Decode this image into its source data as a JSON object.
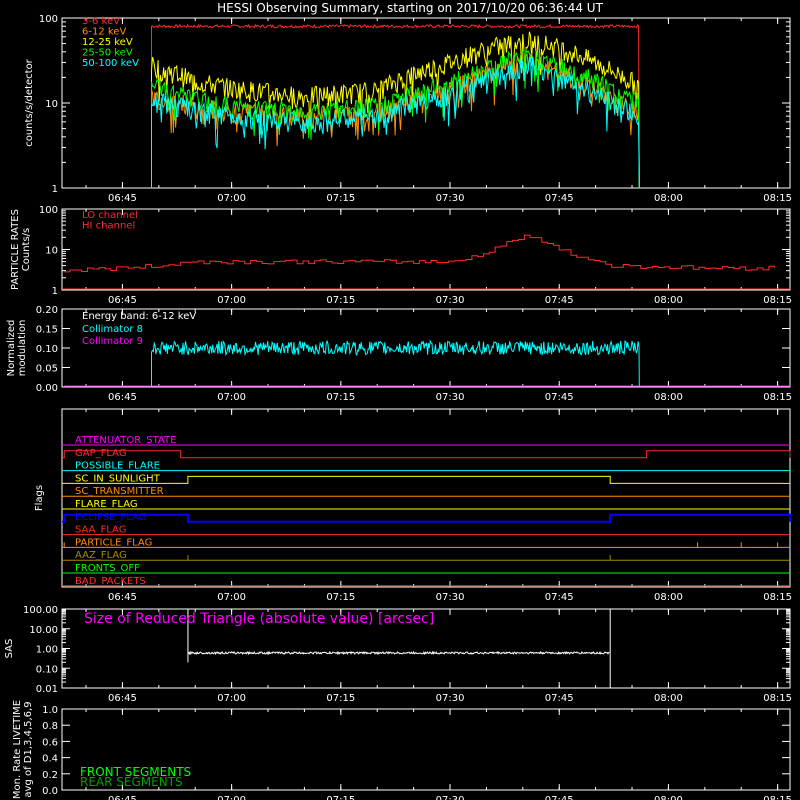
{
  "title": "HESSI Observing Summary, starting on 2017/10/20 06:36:44 UT",
  "colors": {
    "axis": "#ffffff",
    "red": "#ff2a2a",
    "orange": "#ff8c00",
    "yellow": "#ffff00",
    "green": "#00ff00",
    "cyan": "#00ffff",
    "magenta": "#ff00ff",
    "blue": "#0000ff",
    "olive": "#a09000",
    "dkgreen": "#00a000",
    "white": "#ffffff"
  },
  "time_axis": {
    "start_min": 396.7,
    "end_min": 496.7,
    "ticks": [
      {
        "min": 405,
        "label": "06:45"
      },
      {
        "min": 420,
        "label": "07:00"
      },
      {
        "min": 435,
        "label": "07:15"
      },
      {
        "min": 450,
        "label": "07:30"
      },
      {
        "min": 465,
        "label": "07:45"
      },
      {
        "min": 480,
        "label": "08:00"
      },
      {
        "min": 495,
        "label": "08:15"
      }
    ]
  },
  "chart_data": [
    {
      "id": "counts",
      "type": "line",
      "ylabel": "counts/s/detector",
      "yscale": "log",
      "ylim": [
        1,
        100
      ],
      "yticks": [
        {
          "v": 1,
          "label": "1"
        },
        {
          "v": 10,
          "label": "10"
        },
        {
          "v": 100,
          "label": "100"
        }
      ],
      "legend_placement": "top-left",
      "x": [
        "06:49",
        "06:55",
        "07:00",
        "07:10",
        "07:20",
        "07:30",
        "07:37",
        "07:41",
        "07:45",
        "07:50",
        "07:53",
        "07:56"
      ],
      "series": [
        {
          "name": "3-6 keV",
          "color": "red",
          "values": [
            80,
            80,
            80,
            80,
            80,
            80,
            80,
            80,
            80,
            80,
            80,
            80
          ]
        },
        {
          "name": "6-12 keV",
          "color": "orange",
          "values": [
            12,
            9,
            8,
            7,
            8,
            14,
            25,
            30,
            22,
            15,
            10,
            8
          ]
        },
        {
          "name": "12-25 keV",
          "color": "yellow",
          "values": [
            28,
            18,
            15,
            12,
            14,
            30,
            48,
            55,
            45,
            30,
            22,
            16
          ]
        },
        {
          "name": "25-50 keV",
          "color": "green",
          "values": [
            16,
            11,
            9,
            8,
            9,
            17,
            30,
            36,
            27,
            18,
            13,
            10
          ]
        },
        {
          "name": "50-100 keV",
          "color": "cyan",
          "values": [
            11,
            8,
            7,
            6,
            7,
            13,
            22,
            28,
            20,
            13,
            9,
            7
          ]
        }
      ]
    },
    {
      "id": "particle",
      "type": "line",
      "ylabel": "PARTICLE RATES\nCounts/s",
      "yscale": "log",
      "ylim": [
        1,
        100
      ],
      "yticks": [
        {
          "v": 1,
          "label": "1"
        },
        {
          "v": 10,
          "label": "10"
        },
        {
          "v": 100,
          "label": "100"
        }
      ],
      "legend_placement": "top-left",
      "x": [
        "06:37",
        "06:45",
        "06:50",
        "06:55",
        "07:10",
        "07:30",
        "07:35",
        "07:38",
        "07:40",
        "07:43",
        "07:47",
        "07:52",
        "08:05",
        "08:15"
      ],
      "series": [
        {
          "name": "LO channel",
          "color": "red",
          "values": []
        },
        {
          "name": "HI channel",
          "color": "red",
          "values": [
            3,
            3.5,
            4,
            5,
            5,
            5,
            8,
            15,
            22,
            15,
            7,
            4,
            3.5,
            3.5
          ]
        }
      ]
    },
    {
      "id": "modulation",
      "type": "line",
      "ylabel": "Normalized\nmodulation",
      "ylim": [
        0,
        0.2
      ],
      "yticks": [
        {
          "v": 0,
          "label": "0.00"
        },
        {
          "v": 0.05,
          "label": "0.05"
        },
        {
          "v": 0.1,
          "label": "0.10"
        },
        {
          "v": 0.15,
          "label": "0.15"
        },
        {
          "v": 0.2,
          "label": "0.20"
        }
      ],
      "legend_placement": "top-left",
      "annotation": "Energy band: 6-12 keV",
      "series": [
        {
          "name": "Collimator 8",
          "color": "cyan",
          "level": 0.1,
          "from": "06:49",
          "to": "07:56"
        },
        {
          "name": "Collimator 9",
          "color": "magenta",
          "level": 0.0,
          "from": "06:37",
          "to": "08:17"
        }
      ]
    },
    {
      "id": "flags",
      "type": "line",
      "ylabel": "Flags",
      "flags": [
        {
          "name": "ATTENUATOR_STATE",
          "color": "magenta",
          "on": []
        },
        {
          "name": "GAP_FLAG",
          "color": "red",
          "on": [
            [
              "06:37",
              "06:53"
            ],
            [
              "07:57",
              "08:17"
            ]
          ]
        },
        {
          "name": "POSSIBLE_FLARE",
          "color": "cyan",
          "on": []
        },
        {
          "name": "SC_IN_SUNLIGHT",
          "color": "yellow",
          "on": [
            [
              "06:54",
              "07:52"
            ]
          ]
        },
        {
          "name": "SC_TRANSMITTER",
          "color": "orange",
          "on": []
        },
        {
          "name": "FLARE_FLAG",
          "color": "yellow",
          "on": []
        },
        {
          "name": "ECLIPSE_FLAG",
          "color": "blue",
          "on": [
            [
              "06:37",
              "06:54"
            ],
            [
              "07:52",
              "08:17"
            ]
          ]
        },
        {
          "name": "SAA_FLAG",
          "color": "red",
          "on": []
        },
        {
          "name": "PARTICLE_FLAG",
          "color": "orange",
          "spikes": [
            "06:37",
            "08:04",
            "08:10",
            "08:15"
          ]
        },
        {
          "name": "AAZ_FLAG",
          "color": "olive",
          "spikes": [
            "06:54",
            "07:52"
          ]
        },
        {
          "name": "FRONTS_OFF",
          "color": "green",
          "on": []
        },
        {
          "name": "BAD_PACKETS",
          "color": "red",
          "on": []
        }
      ]
    },
    {
      "id": "sas",
      "type": "line",
      "ylabel": "SAS",
      "yscale": "log",
      "ylim": [
        0.01,
        100
      ],
      "yticks": [
        {
          "v": 0.01,
          "label": "0.01"
        },
        {
          "v": 0.1,
          "label": "0.10"
        },
        {
          "v": 1,
          "label": "1.00"
        },
        {
          "v": 10,
          "label": "10.00"
        },
        {
          "v": 100,
          "label": "100.00"
        }
      ],
      "annotation": "Size of Reduced Triangle (absolute value) [arcsec]",
      "series": [
        {
          "name": "",
          "color": "white",
          "level": 0.6,
          "from": "06:54",
          "to": "07:52"
        }
      ]
    },
    {
      "id": "livetime",
      "type": "line",
      "ylabel": "Mon. Rate LIVETIME\navg of D1,3,4,5,6,9",
      "ylim": [
        0,
        1
      ],
      "yticks": [
        {
          "v": 0,
          "label": "0.0"
        },
        {
          "v": 0.2,
          "label": "0.2"
        },
        {
          "v": 0.4,
          "label": "0.4"
        },
        {
          "v": 0.6,
          "label": "0.6"
        },
        {
          "v": 0.8,
          "label": "0.8"
        },
        {
          "v": 1.0,
          "label": "1.0"
        }
      ],
      "legend_placement": "bottom-left",
      "series": [
        {
          "name": "FRONT SEGMENTS",
          "color": "green",
          "values": []
        },
        {
          "name": "REAR SEGMENTS",
          "color": "dkgreen",
          "values": []
        }
      ]
    }
  ]
}
